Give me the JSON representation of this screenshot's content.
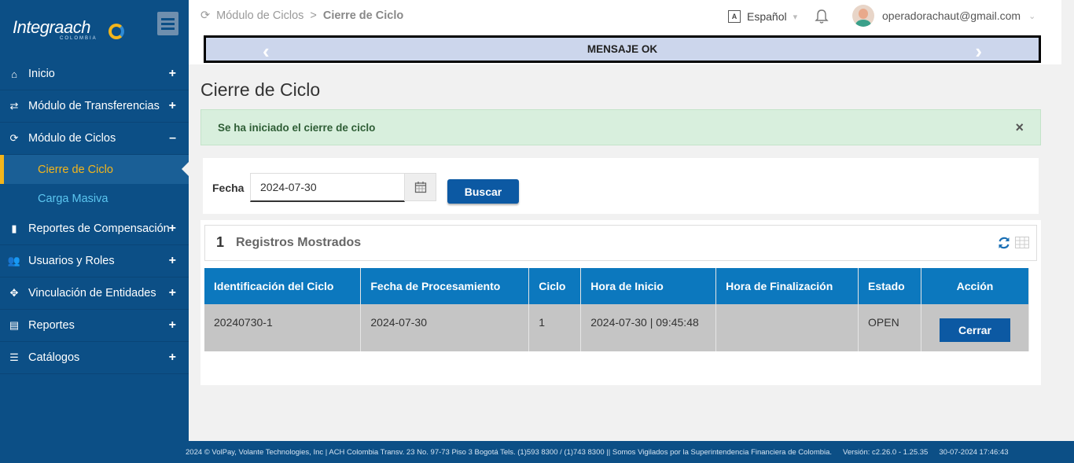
{
  "brand": {
    "logo_text": "Integraach",
    "logo_subtext": "COLOMBIA"
  },
  "sidebar": {
    "items": [
      {
        "label": "Inicio",
        "icon": "home-icon",
        "toggle": "+"
      },
      {
        "label": "Módulo de Transferencias",
        "icon": "transfer-icon",
        "toggle": "+"
      },
      {
        "label": "Módulo de Ciclos",
        "icon": "refresh-icon",
        "toggle": "–"
      },
      {
        "label": "Reportes de Compensación",
        "icon": "file-icon",
        "toggle": "+"
      },
      {
        "label": "Usuarios y Roles",
        "icon": "users-icon",
        "toggle": "+"
      },
      {
        "label": "Vinculación de Entidades",
        "icon": "crosshair-icon",
        "toggle": "+"
      },
      {
        "label": "Reportes",
        "icon": "document-icon",
        "toggle": "+"
      },
      {
        "label": "Catálogos",
        "icon": "list-icon",
        "toggle": "+"
      }
    ],
    "sub_items": [
      {
        "label": "Cierre de Ciclo"
      },
      {
        "label": "Carga Masiva"
      }
    ]
  },
  "breadcrumb": {
    "parent": "Módulo de Ciclos",
    "separator": ">",
    "current": "Cierre de Ciclo"
  },
  "header": {
    "language": "Español",
    "user_email": "operadorachaut@gmail.com"
  },
  "message_bar": {
    "text": "MENSAJE OK"
  },
  "page": {
    "title": "Cierre de Ciclo"
  },
  "alert": {
    "text": "Se ha iniciado el cierre de ciclo",
    "close": "×"
  },
  "filter": {
    "label": "Fecha",
    "date_value": "2024-07-30",
    "search_button": "Buscar"
  },
  "results": {
    "count": "1",
    "count_label": "Registros Mostrados",
    "columns": [
      "Identificación del Ciclo",
      "Fecha de Procesamiento",
      "Ciclo",
      "Hora de Inicio",
      "Hora de Finalización",
      "Estado",
      "Acción"
    ],
    "rows": [
      {
        "id": "20240730-1",
        "fecha": "2024-07-30",
        "ciclo": "1",
        "inicio": "2024-07-30 | 09:45:48",
        "fin": "",
        "estado": "OPEN",
        "accion": "Cerrar"
      }
    ]
  },
  "footer": {
    "copyright": "2024 © VolPay, Volante Technologies, Inc | ACH Colombia Transv. 23 No. 97-73 Piso 3 Bogotá Tels. (1)593 8300 / (1)743 8300 || Somos Vigilados por la Superintendencia Financiera de Colombia.",
    "version": "Versión: c2.26.0 - 1.25.35",
    "datetime": "30-07-2024 17:46:43"
  },
  "colors": {
    "sidebar": "#0c4f86",
    "accent": "#f3b51b",
    "table_header": "#0c78be",
    "button": "#0c59a3"
  }
}
